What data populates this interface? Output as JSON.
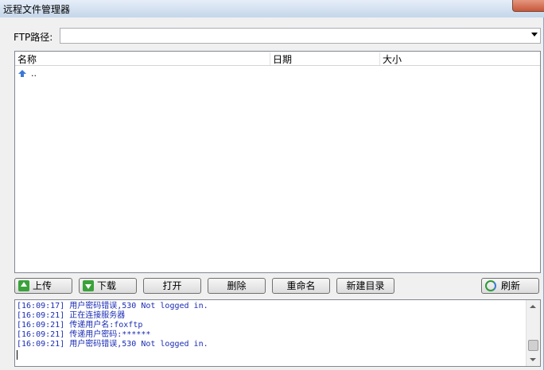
{
  "window": {
    "title": "远程文件管理器"
  },
  "ftp": {
    "path_label": "FTP路径:",
    "path_value": ""
  },
  "file_list": {
    "columns": [
      "名称",
      "日期",
      "大小"
    ],
    "rows": [
      {
        "name": "..",
        "icon": "up-folder-icon"
      }
    ]
  },
  "toolbar": {
    "upload": "上传",
    "download": "下载",
    "open": "打开",
    "delete": "删除",
    "rename": "重命名",
    "new_folder": "新建目录",
    "refresh": "刷新"
  },
  "log": {
    "lines": [
      "[16:09:17] 用户密码错误,530 Not logged in.",
      "[16:09:21] 正在连接服务器",
      "[16:09:21] 传递用户名:foxftp",
      "[16:09:21] 传递用户密码:******",
      "[16:09:21] 用户密码错误,530 Not logged in."
    ]
  },
  "colors": {
    "log_text": "#1a2cb4",
    "accent_green": "#3aa23a",
    "accent_blue": "#3a78d8"
  }
}
